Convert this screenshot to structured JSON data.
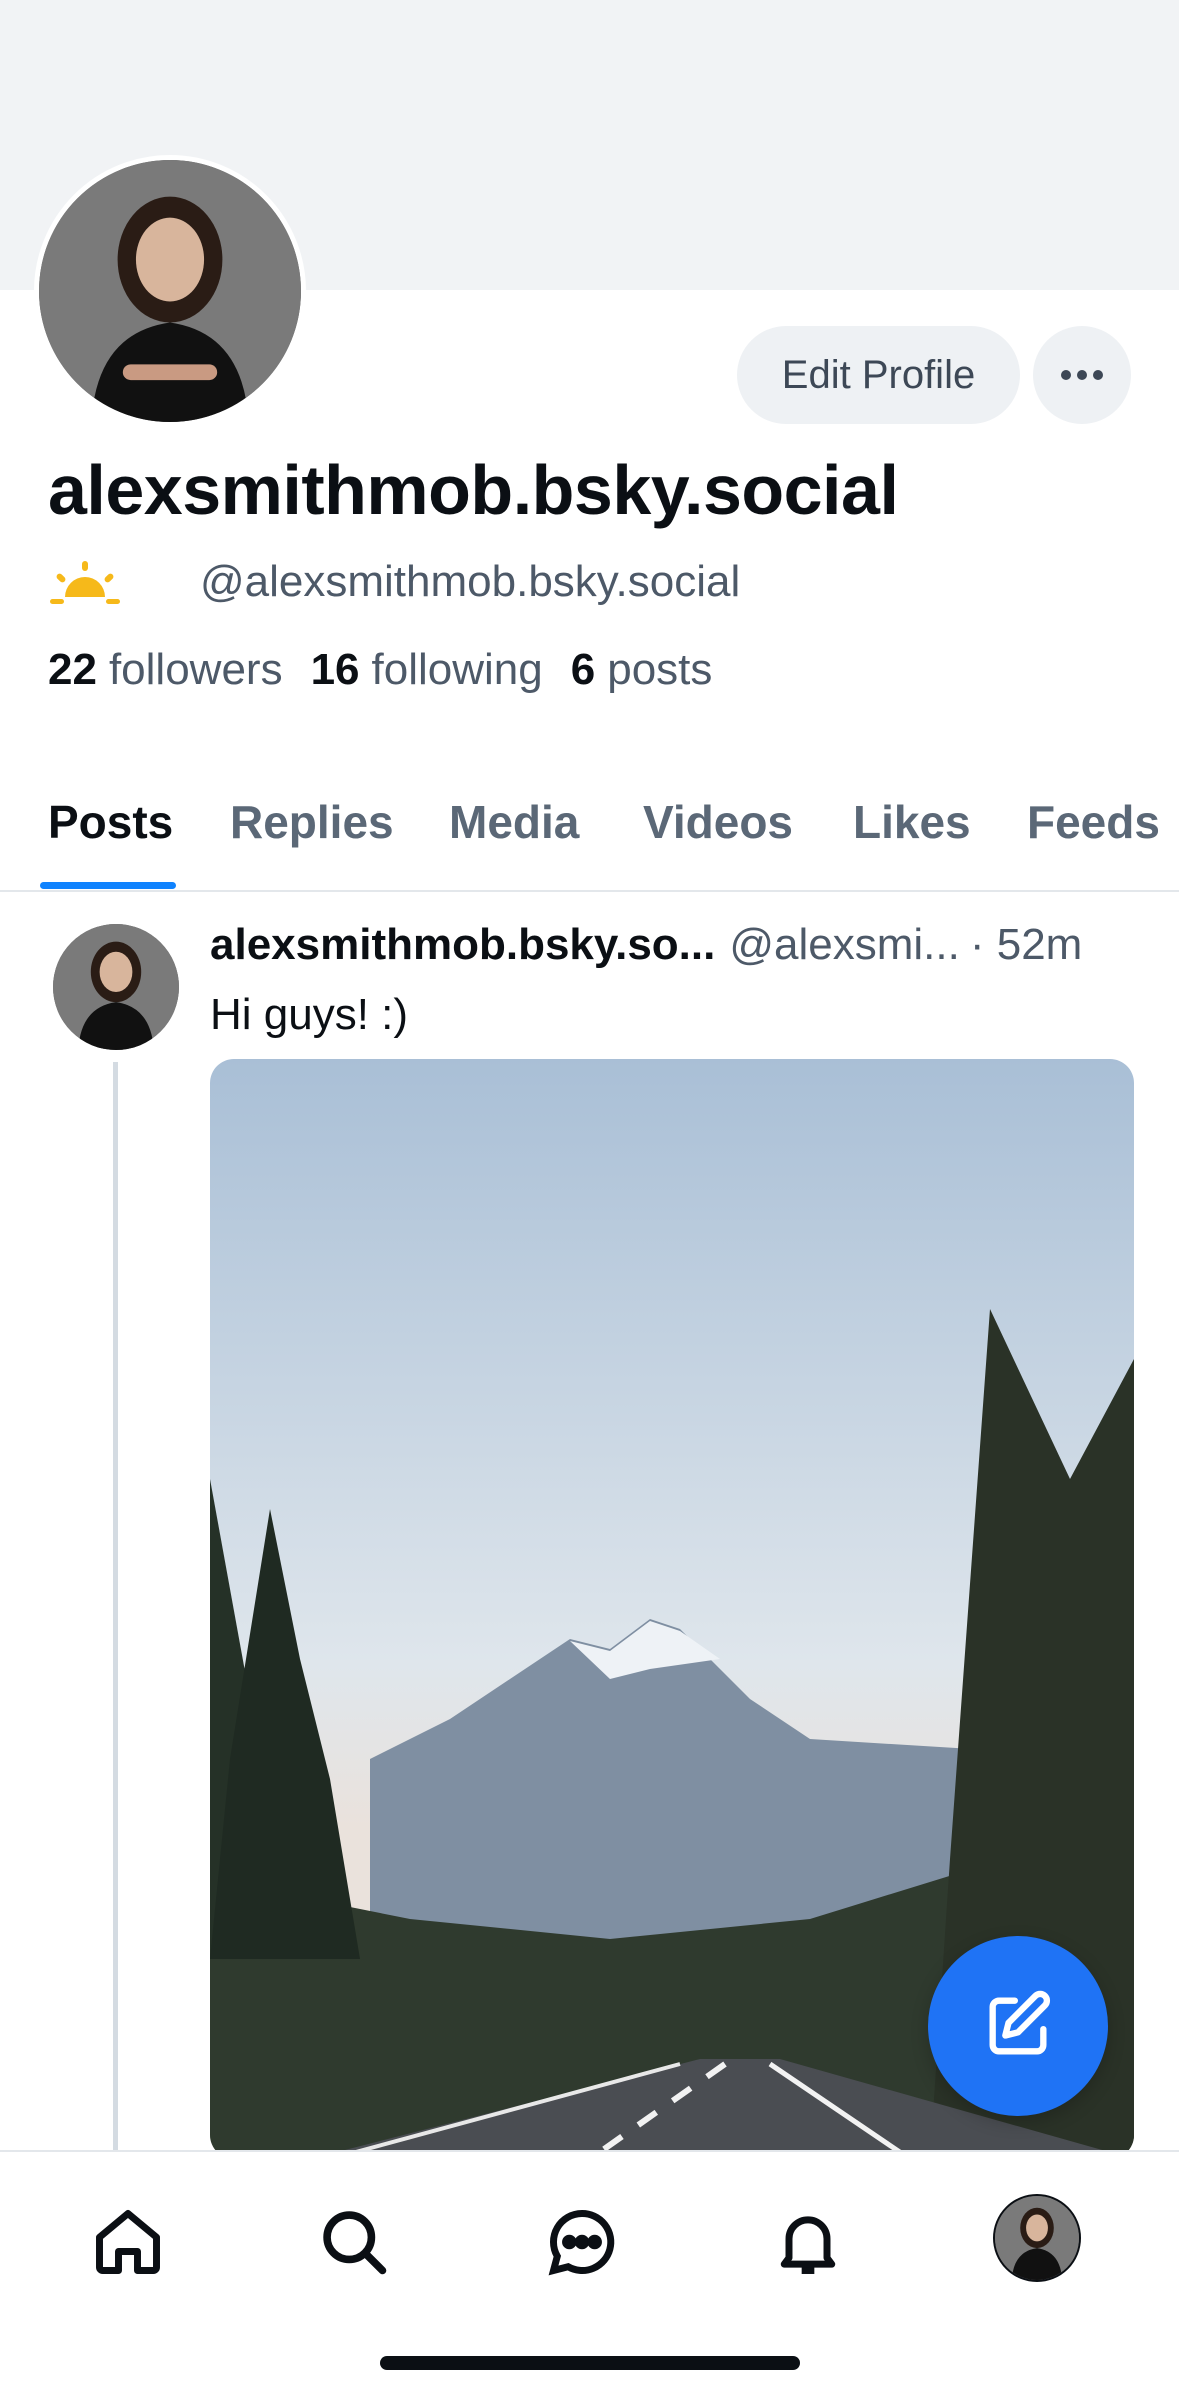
{
  "profile": {
    "display_name": "alexsmithmob.bsky.social",
    "handle": "@alexsmithmob.bsky.social",
    "status_icon": "sun-icon",
    "edit_label": "Edit Profile",
    "stats": {
      "followers_count": "22",
      "followers_label": "followers",
      "following_count": "16",
      "following_label": "following",
      "posts_count": "6",
      "posts_label": "posts"
    }
  },
  "tabs": [
    {
      "label": "Posts"
    },
    {
      "label": "Replies"
    },
    {
      "label": "Media"
    },
    {
      "label": "Videos"
    },
    {
      "label": "Likes"
    },
    {
      "label": "Feeds"
    }
  ],
  "post": {
    "author": "alexsmithmob.bsky.so...",
    "handle": "@alexsmi...",
    "time": "· 52m",
    "text": "Hi guys! :)"
  },
  "nav": {
    "items": [
      "home-icon",
      "search-icon",
      "chat-icon",
      "bell-icon",
      "profile-avatar"
    ]
  },
  "colors": {
    "accent": "#1083fe",
    "fab": "#1f73f5"
  }
}
